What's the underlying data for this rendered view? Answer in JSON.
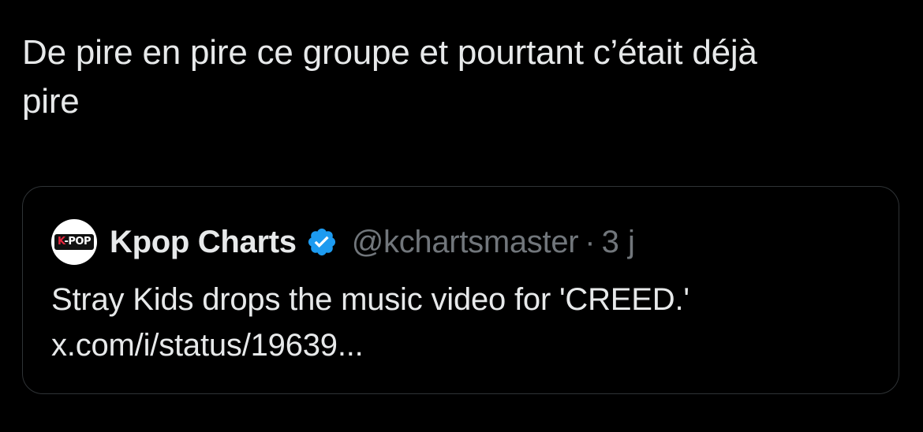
{
  "tweet": {
    "text_line1": "De pire en pire ce groupe et pourtant c’était déjà",
    "text_line2": "pire"
  },
  "quote": {
    "avatar_label": "K-POP",
    "display_name": "Kpop Charts",
    "verified_icon": "verified-badge-icon",
    "handle": "@kchartsmaster",
    "separator": "·",
    "time": "3 j",
    "body_line1": "Stray Kids drops the music video for 'CREED.'",
    "body_line2": "x.com/i/status/19639..."
  },
  "colors": {
    "background": "#000000",
    "text_primary": "#e7e9ea",
    "text_secondary": "#71767b",
    "border": "#2f3336",
    "verified_blue": "#1d9bf0"
  }
}
